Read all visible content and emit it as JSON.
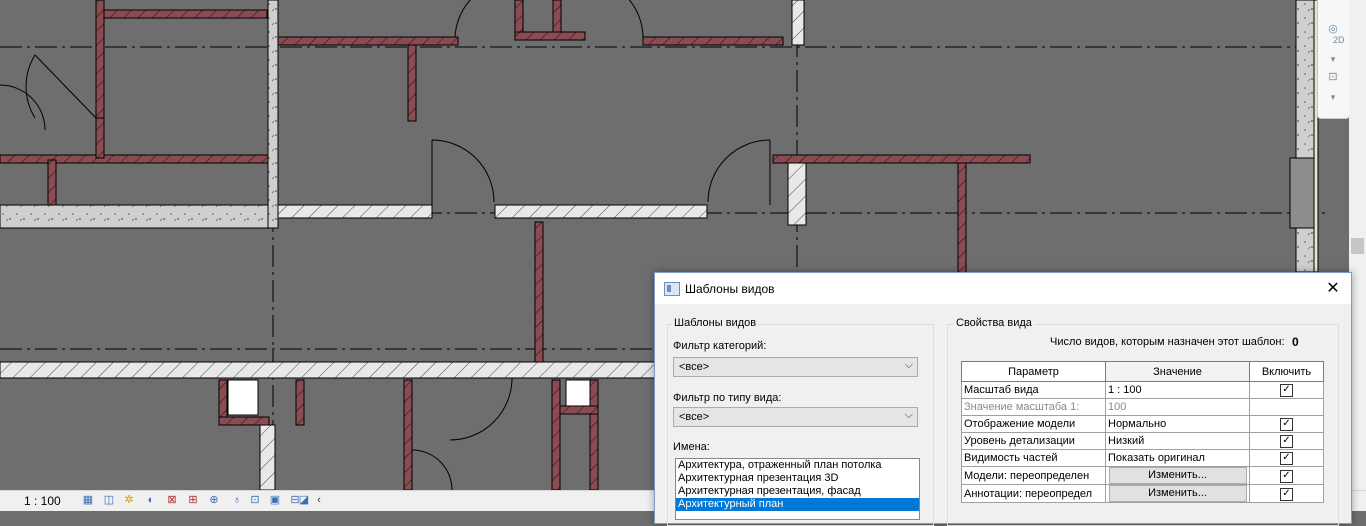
{
  "view": {
    "scale": "1 : 100"
  },
  "colors": {
    "canvas": "#6e6e6e",
    "cut_wall": "#8a4b52",
    "outline": "#000000",
    "selected": "#0078d7"
  },
  "navbar": {
    "icons": [
      "navigation-wheel-icon",
      "zoom-region-icon"
    ],
    "label_2d": "2D"
  },
  "statusbar": {
    "scale": "1 : 100",
    "icons": [
      "detail-level-icon",
      "visual-style-icon",
      "sun-path-icon",
      "shadows-icon",
      "crop-view-icon",
      "show-crop-icon",
      "temporary-hide-icon",
      "reveal-hidden-icon",
      "lock-3d-icon",
      "analysis-display-icon",
      "highlight-displacement-icon",
      "hide-analytical-icon",
      "collapse-icon"
    ]
  },
  "dialog": {
    "title": "Шаблоны видов",
    "left": {
      "group_label": "Шаблоны видов",
      "category_filter_label": "Фильтр категорий:",
      "category_filter_value": "<все>",
      "viewtype_filter_label": "Фильтр по типу вида:",
      "viewtype_filter_value": "<все>",
      "names_label": "Имена:",
      "names": [
        "Архитектура, отраженный план потолка",
        "Архитектурная презентация 3D",
        "Архитектурная презентация, фасад",
        "Архитектурный план"
      ],
      "selected_index": 3
    },
    "right": {
      "group_label": "Свойства вида",
      "count_label": "Число видов, которым назначен этот шаблон:",
      "count_value": "0",
      "columns": [
        "Параметр",
        "Значение",
        "Включить"
      ],
      "rows": [
        {
          "param": "Масштаб вида",
          "value": "1 : 100",
          "checked": true,
          "button": false,
          "dimmed": false
        },
        {
          "param": "Значение масштаба   1:",
          "value": "100",
          "checked": null,
          "button": false,
          "dimmed": true
        },
        {
          "param": "Отображение модели",
          "value": "Нормально",
          "checked": true,
          "button": false,
          "dimmed": false
        },
        {
          "param": "Уровень детализации",
          "value": "Низкий",
          "checked": true,
          "button": false,
          "dimmed": false
        },
        {
          "param": "Видимость частей",
          "value": "Показать оригинал",
          "checked": true,
          "button": false,
          "dimmed": false
        },
        {
          "param": "Модели: переопределен",
          "value": "Изменить...",
          "checked": true,
          "button": true,
          "dimmed": false
        },
        {
          "param": "Аннотации: переопредел",
          "value": "Изменить...",
          "checked": true,
          "button": true,
          "dimmed": false
        }
      ]
    }
  }
}
